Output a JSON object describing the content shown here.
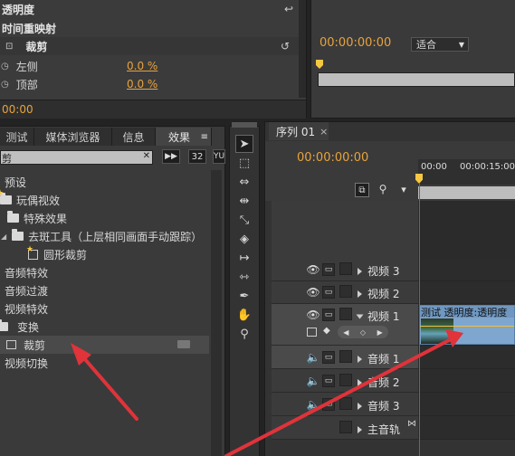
{
  "effect_controls": {
    "row_opacity": "透明度",
    "row_time_remap": "时间重映射",
    "row_crop": "裁剪",
    "crop_left_label": "左侧",
    "crop_left_value": "0.0 %",
    "crop_top_label": "顶部",
    "crop_top_value": "0.0 %",
    "timecode": "00:00"
  },
  "program_monitor": {
    "timecode": "00:00:00:00",
    "fit_label": "适合"
  },
  "project_tabs": {
    "tab_info_partial": "测试",
    "tab_media_browser": "媒体浏览器",
    "tab_info": "信息",
    "tab_effects": "效果",
    "tab_menu": "≡"
  },
  "effects_panel": {
    "search_value": "剪",
    "search_clear": "✕",
    "btn_32": "32",
    "btn_yuv": "YU",
    "items": [
      {
        "label": "预设",
        "kind": "text"
      },
      {
        "label": "玩偶视效",
        "kind": "folder"
      },
      {
        "label": "特殊效果",
        "kind": "folder"
      },
      {
        "label": "去斑工具（上层相同画面手动跟踪）",
        "kind": "folder"
      },
      {
        "label": "圆形裁剪",
        "kind": "preset"
      },
      {
        "label": "音频特效",
        "kind": "text"
      },
      {
        "label": "音频过渡",
        "kind": "text"
      },
      {
        "label": "视频特效",
        "kind": "text"
      },
      {
        "label": "变换",
        "kind": "folder"
      },
      {
        "label": "裁剪",
        "kind": "effect"
      },
      {
        "label": "视频切换",
        "kind": "text"
      }
    ]
  },
  "sequence": {
    "tab_title": "序列 01",
    "tab_close": "×",
    "timecode": "00:00:00:00",
    "ruler_start": "00:00",
    "ruler_mark": "00:00:15:00",
    "tracks": [
      {
        "label": "视频 3"
      },
      {
        "label": "视频 2"
      },
      {
        "label": "视频 1"
      },
      {
        "label": "音频 1"
      },
      {
        "label": "音频 2"
      },
      {
        "label": "音频 3"
      },
      {
        "label": "主音轨"
      }
    ],
    "clip_label": "测试 透明度:透明度"
  },
  "colors": {
    "accent_orange": "#e8a33d",
    "arrow_red": "#e0333a",
    "panel_bg": "#3a3a3a",
    "clip_blue": "#7ea6cf"
  }
}
